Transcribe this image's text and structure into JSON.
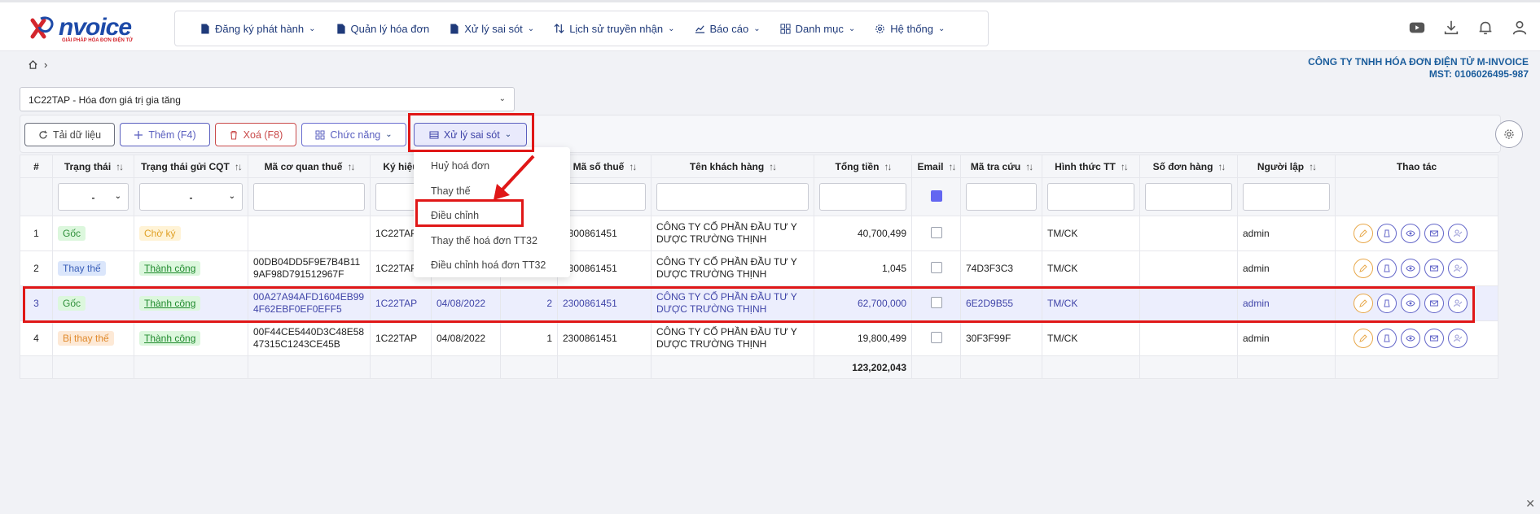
{
  "app": {
    "logo_text": "nvoice",
    "logo_tagline": "GIẢI PHÁP HÓA ĐƠN ĐIỆN TỬ"
  },
  "nav": [
    {
      "label": "Đăng ký phát hành",
      "icon": "file-register-icon",
      "has_dropdown": true
    },
    {
      "label": "Quản lý hóa đơn",
      "icon": "file-icon",
      "has_dropdown": false
    },
    {
      "label": "Xử lý sai sót",
      "icon": "file-edit-icon",
      "has_dropdown": true
    },
    {
      "label": "Lịch sử truyền nhận",
      "icon": "transfer-icon",
      "has_dropdown": true
    },
    {
      "label": "Báo cáo",
      "icon": "chart-line-icon",
      "has_dropdown": true
    },
    {
      "label": "Danh mục",
      "icon": "grid-icon",
      "has_dropdown": true
    },
    {
      "label": "Hệ thống",
      "icon": "gear-icon",
      "has_dropdown": true
    }
  ],
  "company": {
    "name": "CÔNG TY TNHH HÓA ĐƠN ĐIỆN TỬ M-INVOICE",
    "tax_id": "MST: 0106026495-987"
  },
  "series_select": {
    "value": "1C22TAP - Hóa đơn giá trị gia tăng"
  },
  "toolbar": {
    "reload": "Tải dữ liệu",
    "add": "Thêm (F4)",
    "delete": "Xoá (F8)",
    "functions": "Chức năng",
    "fix_errors": "Xử lý sai sót"
  },
  "dropdown": {
    "items": [
      "Huỷ hoá đơn",
      "Thay thế",
      "Điều chỉnh",
      "Thay thế hoá đơn TT32",
      "Điều chỉnh hoá đơn TT32"
    ],
    "highlighted": "Điều chỉnh"
  },
  "table": {
    "headers": {
      "num": "#",
      "status": "Trạng thái",
      "cqt_status": "Trạng thái gửi CQT",
      "tax_code": "Mã cơ quan thuế",
      "symbol": "Ký hiệu",
      "tax_no": "Mã số thuế",
      "customer": "Tên khách hàng",
      "total": "Tổng tiền",
      "email": "Email",
      "lookup": "Mã tra cứu",
      "payment": "Hình thức TT",
      "order_no": "Số đơn hàng",
      "creator": "Người lập",
      "actions": "Thao tác"
    },
    "filters": {
      "status": "-",
      "cqt_status": "-"
    },
    "rows": [
      {
        "num": "1",
        "status": "Gốc",
        "status_kind": "goc",
        "cqt": "Chờ ký",
        "cqt_kind": "cho",
        "tax_code": "",
        "symbol": "1C22TAP",
        "date": "",
        "invoice_no": "",
        "tax_no": "2300861451",
        "customer": "CÔNG TY CỔ PHẦN ĐẦU TƯ Y DƯỢC TRƯỜNG THỊNH",
        "total": "40,700,499",
        "lookup": "",
        "payment": "TM/CK",
        "order_no": "",
        "creator": "admin"
      },
      {
        "num": "2",
        "status": "Thay thế",
        "status_kind": "thay",
        "cqt": "Thành công",
        "cqt_kind": "ok",
        "tax_code": "00DB04DD5F9E7B4B119AF98D791512967F",
        "symbol": "1C22TAP",
        "date": "",
        "invoice_no": "",
        "tax_no": "2300861451",
        "customer": "CÔNG TY CỔ PHẦN ĐẦU TƯ Y DƯỢC TRƯỜNG THỊNH",
        "total": "1,045",
        "lookup": "74D3F3C3",
        "payment": "TM/CK",
        "order_no": "",
        "creator": "admin"
      },
      {
        "num": "3",
        "status": "Gốc",
        "status_kind": "goc",
        "cqt": "Thành công",
        "cqt_kind": "ok",
        "tax_code": "00A27A94AFD1604EB994F62EBF0EF0EFF5",
        "symbol": "1C22TAP",
        "date": "04/08/2022",
        "invoice_no": "2",
        "tax_no": "2300861451",
        "customer": "CÔNG TY CỔ PHẦN ĐẦU TƯ Y DƯỢC TRƯỜNG THỊNH",
        "total": "62,700,000",
        "lookup": "6E2D9B55",
        "payment": "TM/CK",
        "order_no": "",
        "creator": "admin"
      },
      {
        "num": "4",
        "status": "Bị thay thế",
        "status_kind": "bi",
        "cqt": "Thành công",
        "cqt_kind": "ok",
        "tax_code": "00F44CE5440D3C48E5847315C1243CE45B",
        "symbol": "1C22TAP",
        "date": "04/08/2022",
        "invoice_no": "1",
        "tax_no": "2300861451",
        "customer": "CÔNG TY CỔ PHẦN ĐẦU TƯ Y DƯỢC TRƯỜNG THỊNH",
        "total": "19,800,499",
        "lookup": "30F3F99F",
        "payment": "TM/CK",
        "order_no": "",
        "creator": "admin"
      }
    ],
    "grand_total": "123,202,043"
  },
  "colors": {
    "accent": "#5a5fbf",
    "annotation": "#e01717",
    "brand": "#1d4aa8"
  }
}
